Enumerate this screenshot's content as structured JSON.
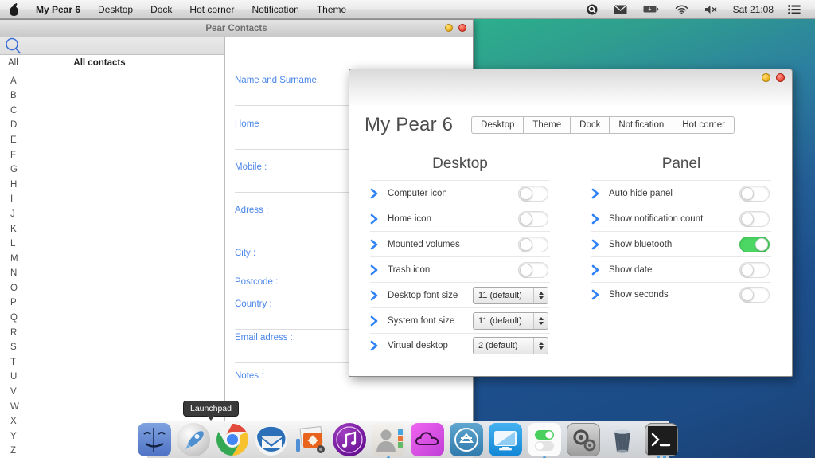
{
  "menubar": {
    "logo_icon": "pear-logo-icon",
    "items": [
      {
        "label": "My Pear 6",
        "bold": true
      },
      {
        "label": "Desktop",
        "bold": false
      },
      {
        "label": "Dock",
        "bold": false
      },
      {
        "label": "Hot corner",
        "bold": false
      },
      {
        "label": "Notification",
        "bold": false
      },
      {
        "label": "Theme",
        "bold": false
      }
    ],
    "status_icons": [
      "search-icon",
      "mail-icon",
      "battery-icon",
      "wifi-icon",
      "volume-mute-icon"
    ],
    "clock": "Sat 21:08",
    "menu_list_icon": "list-menu-icon"
  },
  "contacts": {
    "title": "Pear Contacts",
    "window_buttons": [
      "minimize-button",
      "close-button"
    ],
    "search_icon": "search-icon",
    "search_value": "",
    "list_header": {
      "all_label": "All",
      "title": "All contacts"
    },
    "alphabet": [
      "A",
      "B",
      "C",
      "D",
      "E",
      "F",
      "G",
      "H",
      "I",
      "J",
      "K",
      "L",
      "M",
      "N",
      "O",
      "P",
      "Q",
      "R",
      "S",
      "T",
      "U",
      "V",
      "W",
      "X",
      "Y",
      "Z"
    ],
    "fields": [
      {
        "label": "Name and Surname",
        "value": ""
      },
      {
        "label": "Home :",
        "value": ""
      },
      {
        "label": "Mobile :",
        "value": ""
      },
      {
        "label": "Adress :",
        "value": ""
      },
      {
        "label": "City :",
        "value": ""
      },
      {
        "label": "Postcode :",
        "value": ""
      },
      {
        "label": "Country :",
        "value": ""
      },
      {
        "label": "Email adress :",
        "value": ""
      },
      {
        "label": "Notes :",
        "value": ""
      }
    ]
  },
  "settings": {
    "title": "My Pear 6",
    "window_buttons": [
      "minimize-button",
      "close-button"
    ],
    "tabs": [
      {
        "label": "Desktop",
        "active": true
      },
      {
        "label": "Theme",
        "active": false
      },
      {
        "label": "Dock",
        "active": false
      },
      {
        "label": "Notification",
        "active": false
      },
      {
        "label": "Hot corner",
        "active": false
      }
    ],
    "left_column": {
      "title": "Desktop",
      "toggles": [
        {
          "label": "Computer icon",
          "state": "off"
        },
        {
          "label": "Home icon",
          "state": "off"
        },
        {
          "label": "Mounted volumes",
          "state": "off"
        },
        {
          "label": "Trash icon",
          "state": "off"
        }
      ],
      "steppers": [
        {
          "label": "Desktop font size",
          "value": "11 (default)"
        },
        {
          "label": "System font size",
          "value": "11 (default)"
        },
        {
          "label": "Virtual desktop",
          "value": "2 (default)"
        }
      ]
    },
    "right_column": {
      "title": "Panel",
      "toggles": [
        {
          "label": "Auto hide panel",
          "state": "off"
        },
        {
          "label": "Show notification count",
          "state": "off"
        },
        {
          "label": "Show bluetooth",
          "state": "on"
        },
        {
          "label": "Show date",
          "state": "off"
        },
        {
          "label": "Show seconds",
          "state": "off"
        }
      ]
    },
    "accent_color": "#2f82f7",
    "toggle_on_color": "#4cd663"
  },
  "dock": {
    "tooltip": "Launchpad",
    "items": [
      {
        "name": "finder",
        "running": false
      },
      {
        "name": "launchpad",
        "running": false
      },
      {
        "name": "chrome",
        "running": true
      },
      {
        "name": "thunderbird",
        "running": false
      },
      {
        "name": "image-editor",
        "running": false
      },
      {
        "name": "music",
        "running": false
      },
      {
        "name": "contacts",
        "running": true
      },
      {
        "name": "cloud",
        "running": false
      },
      {
        "name": "cydia",
        "running": false
      },
      {
        "name": "display",
        "running": false
      },
      {
        "name": "settings-toggles",
        "running": true
      },
      {
        "name": "system-preferences",
        "running": false
      },
      {
        "name": "trash",
        "running": false
      },
      {
        "name": "terminal",
        "running": true
      }
    ]
  }
}
